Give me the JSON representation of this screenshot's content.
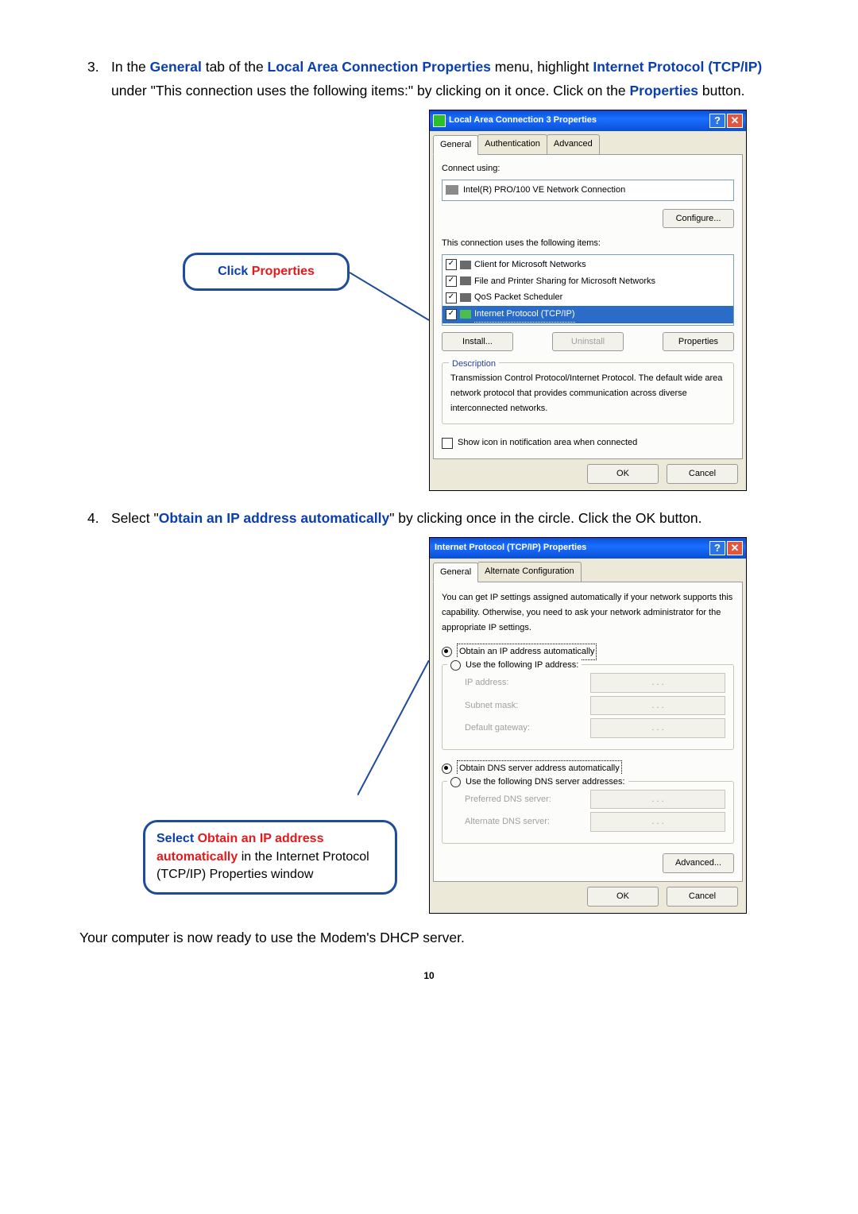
{
  "steps": {
    "3": {
      "num": "3.",
      "t1": "  In the ",
      "b1": "General",
      "t2": " tab of the ",
      "b2": "Local Area Connection Properties",
      "t3": " menu, highlight ",
      "b3": "Internet Protocol (TCP/IP)",
      "t4": " under \"This connection uses the following items:\" by clicking on it once. Click on the ",
      "b4": "Properties",
      "t5": " button."
    },
    "4": {
      "num": "4.",
      "t1": "  Select \"",
      "b1": "Obtain an IP address automatically",
      "t2": "\" by clicking once in the circle. Click the OK button."
    }
  },
  "callout1": {
    "a": "Click ",
    "b": "Properties"
  },
  "callout2": {
    "a": "Select ",
    "b": "Obtain an IP address automatically",
    "c": " in the Internet Protocol (TCP/IP) Properties window"
  },
  "closing": "Your computer is now ready to use the Modem's DHCP server.",
  "page_number": "10",
  "win1": {
    "title": "Local Area Connection 3 Properties",
    "help": "?",
    "close": "✕",
    "tabs": {
      "general": "General",
      "auth": "Authentication",
      "adv": "Advanced"
    },
    "connect_using_label": "Connect using:",
    "nic": "Intel(R) PRO/100 VE Network Connection",
    "configure": "Configure...",
    "items_label": "This connection uses the following items:",
    "items": [
      "Client for Microsoft Networks",
      "File and Printer Sharing for Microsoft Networks",
      "QoS Packet Scheduler",
      "Internet Protocol (TCP/IP)"
    ],
    "install": "Install...",
    "uninstall": "Uninstall",
    "properties": "Properties",
    "desc_legend": "Description",
    "desc_text": "Transmission Control Protocol/Internet Protocol. The default wide area network protocol that provides communication across diverse interconnected networks.",
    "show_icon": "Show icon in notification area when connected",
    "ok": "OK",
    "cancel": "Cancel"
  },
  "win2": {
    "title": "Internet Protocol (TCP/IP) Properties",
    "help": "?",
    "close": "✕",
    "tabs": {
      "general": "General",
      "alt": "Alternate Configuration"
    },
    "intro": "You can get IP settings assigned automatically if your network supports this capability. Otherwise, you need to ask your network administrator for the appropriate IP settings.",
    "r_auto_ip": "Obtain an IP address automatically",
    "r_use_ip": "Use the following IP address:",
    "lbl_ip": "IP address:",
    "lbl_mask": "Subnet mask:",
    "lbl_gw": "Default gateway:",
    "r_auto_dns": "Obtain DNS server address automatically",
    "r_use_dns": "Use the following DNS server addresses:",
    "lbl_pdns": "Preferred DNS server:",
    "lbl_adns": "Alternate DNS server:",
    "ip_placeholder": ".      .      .",
    "advanced": "Advanced...",
    "ok": "OK",
    "cancel": "Cancel"
  }
}
